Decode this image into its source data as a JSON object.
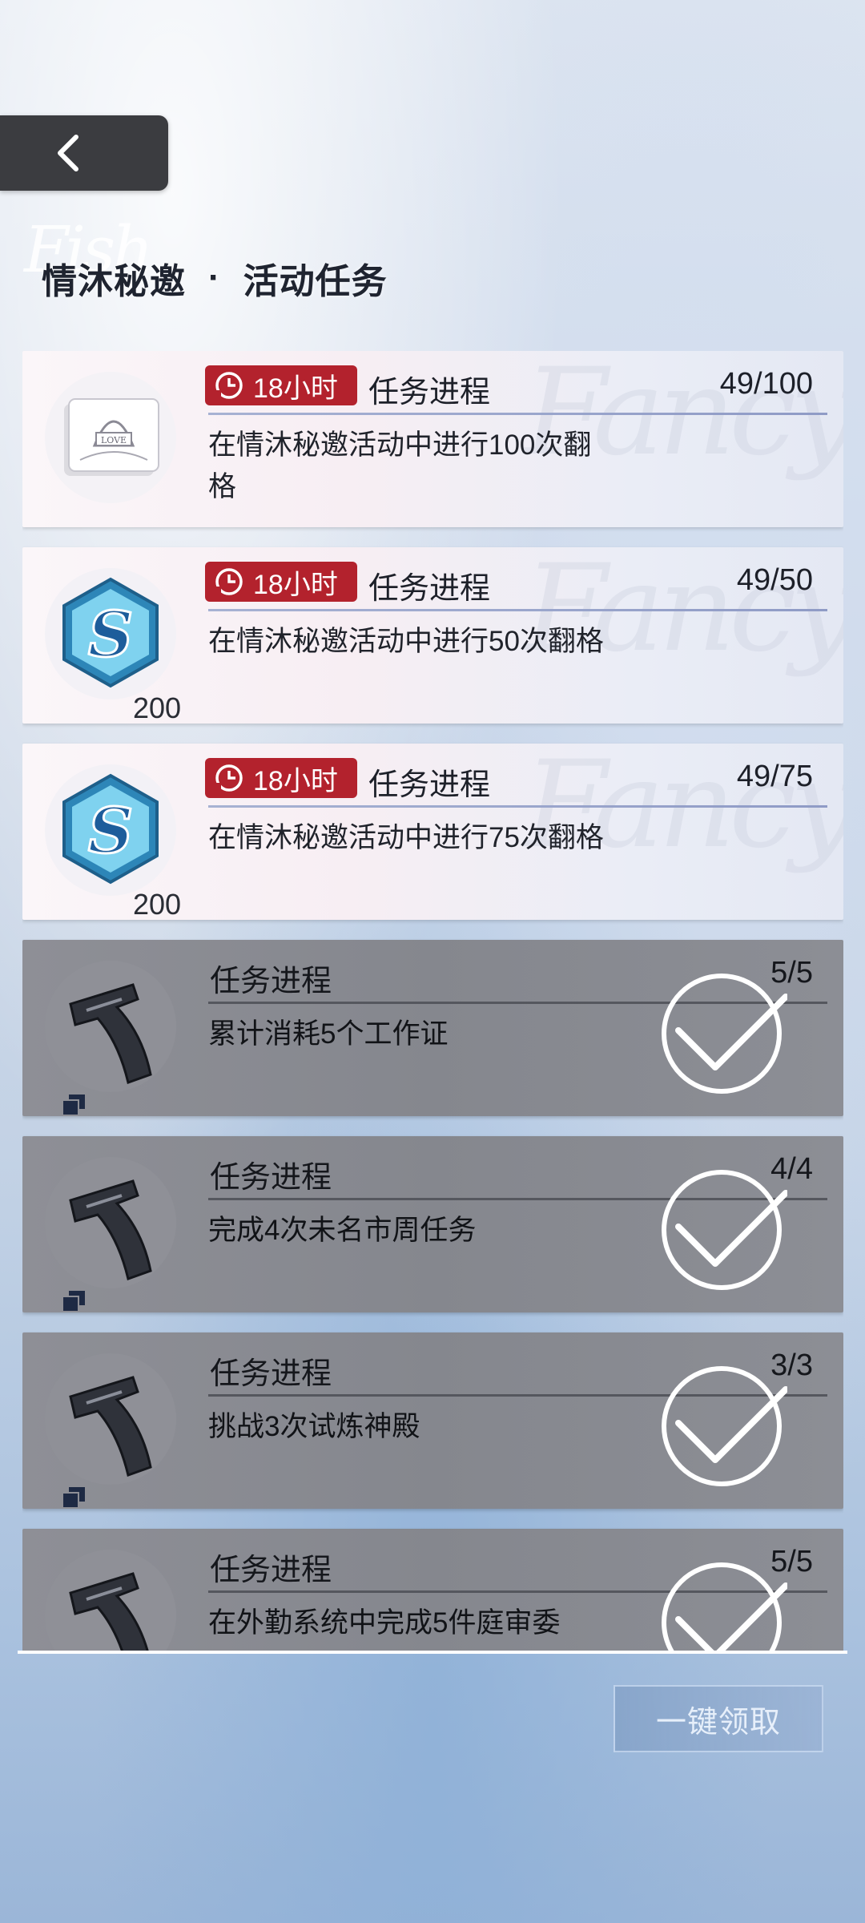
{
  "header": {
    "back_icon": "chevron-left-icon",
    "title_left": "情沐秘邀",
    "title_sep": "·",
    "title_right": "活动任务",
    "title_script": "Fish"
  },
  "colors": {
    "timer_badge": "#b3222d",
    "done_card": "#8a8c93",
    "active_card": "#f5eff4"
  },
  "tasks": [
    {
      "state": "active",
      "reward_icon": "love-card-icon",
      "reward_count": "",
      "timer": "18小时",
      "progress_label": "任务进程",
      "progress": "49/100",
      "description": "在情沐秘邀活动中进行100次翻格"
    },
    {
      "state": "active",
      "reward_icon": "s-coin-icon",
      "reward_count": "200",
      "timer": "18小时",
      "progress_label": "任务进程",
      "progress": "49/50",
      "description": "在情沐秘邀活动中进行50次翻格"
    },
    {
      "state": "active",
      "reward_icon": "s-coin-icon",
      "reward_count": "200",
      "timer": "18小时",
      "progress_label": "任务进程",
      "progress": "49/75",
      "description": "在情沐秘邀活动中进行75次翻格"
    },
    {
      "state": "done",
      "reward_icon": "handle-tool-icon",
      "progress_label": "任务进程",
      "progress": "5/5",
      "description": "累计消耗5个工作证"
    },
    {
      "state": "done",
      "reward_icon": "handle-tool-icon",
      "progress_label": "任务进程",
      "progress": "4/4",
      "description": "完成4次未名市周任务"
    },
    {
      "state": "done",
      "reward_icon": "handle-tool-icon",
      "progress_label": "任务进程",
      "progress": "3/3",
      "description": "挑战3次试炼神殿"
    },
    {
      "state": "done",
      "reward_icon": "handle-tool-icon",
      "progress_label": "任务进程",
      "progress": "5/5",
      "description": "在外勤系统中完成5件庭审委"
    }
  ],
  "footer": {
    "claim_all_label": "一键领取"
  }
}
